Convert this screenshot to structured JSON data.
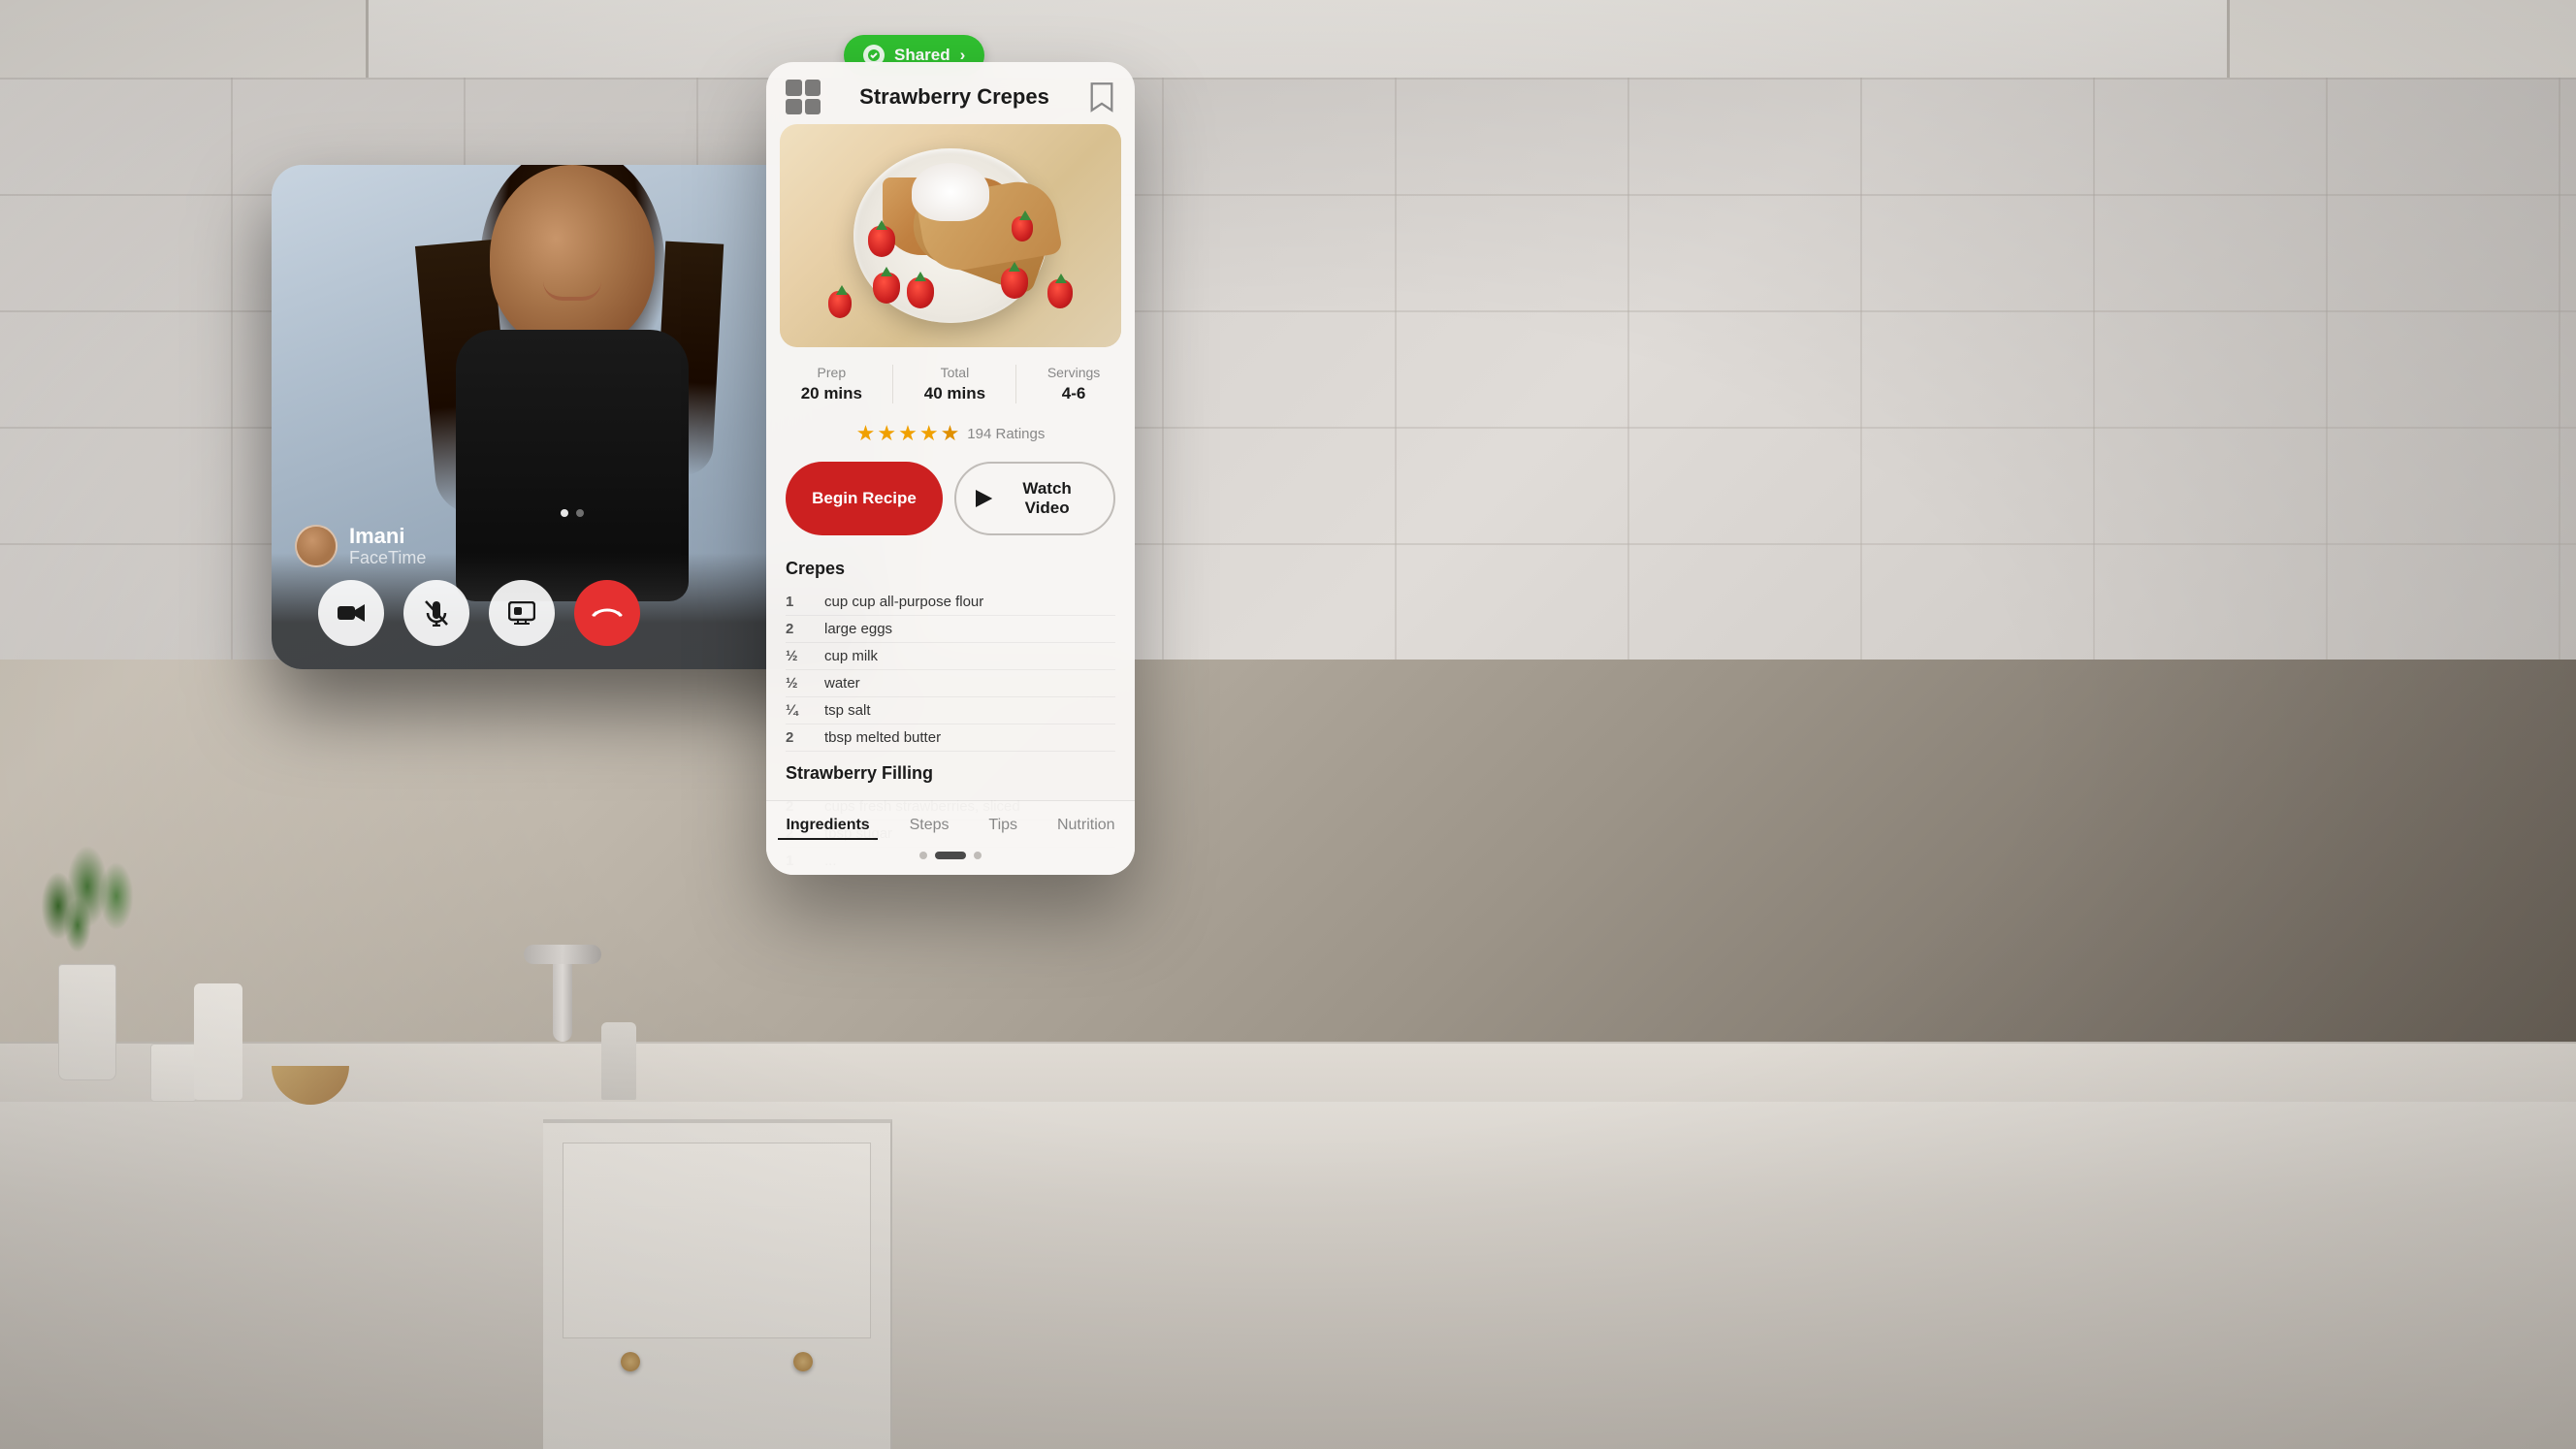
{
  "scene": {
    "background": "kitchen"
  },
  "shared_badge": {
    "label": "Shared",
    "arrow": "›"
  },
  "facetime": {
    "caller_name": "Imani",
    "caller_app": "FaceTime",
    "dot_indicators": [
      true,
      false
    ],
    "controls": {
      "camera_label": "camera",
      "mute_label": "mute",
      "screen_label": "screen",
      "end_label": "end"
    }
  },
  "recipe": {
    "title": "Strawberry Crepes",
    "prep_label": "Prep",
    "prep_value": "20 mins",
    "total_label": "Total",
    "total_value": "40 mins",
    "servings_label": "Servings",
    "servings_value": "4-6",
    "rating_count": "194 Ratings",
    "begin_label": "Begin Recipe",
    "watch_label": "Watch Video",
    "sections": [
      {
        "name": "Crepes",
        "ingredients": [
          {
            "qty": "1",
            "item": "cup cup all-purpose flour"
          },
          {
            "qty": "2",
            "item": "large eggs"
          },
          {
            "qty": "½",
            "item": "cup milk"
          },
          {
            "qty": "½",
            "item": "water"
          },
          {
            "qty": "¼",
            "item": "tsp salt"
          },
          {
            "qty": "2",
            "item": "tbsp melted butter"
          }
        ]
      },
      {
        "name": "Strawberry Filling",
        "ingredients": [
          {
            "qty": "2",
            "item": "cups fresh strawberries, sliced"
          },
          {
            "qty": "2",
            "item": "tbsp sugar"
          },
          {
            "qty": "1",
            "item": "..."
          }
        ]
      }
    ],
    "tabs": [
      {
        "label": "Ingredients",
        "active": true
      },
      {
        "label": "Steps",
        "active": false
      },
      {
        "label": "Tips",
        "active": false
      },
      {
        "label": "Nutrition",
        "active": false
      }
    ]
  }
}
